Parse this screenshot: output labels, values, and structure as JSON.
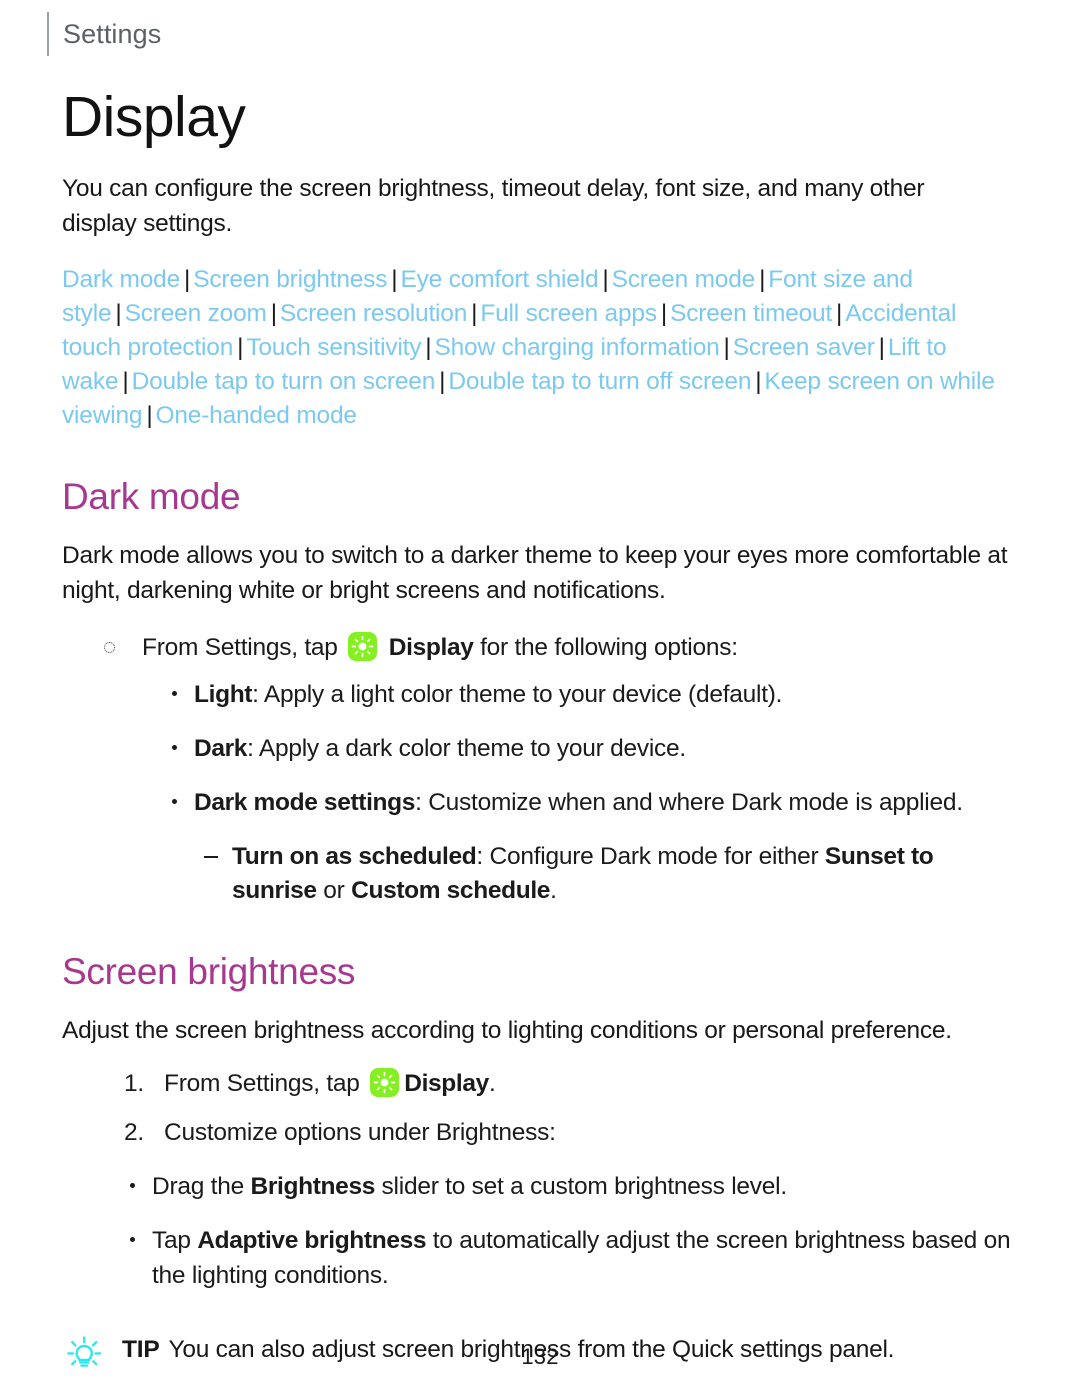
{
  "header": {
    "running_label": "Settings"
  },
  "page": {
    "title": "Display",
    "intro": "You can configure the screen brightness, timeout delay, font size, and many other display settings.",
    "folio": "132"
  },
  "quick_links": {
    "separator": "|",
    "items": [
      "Dark mode",
      "Screen brightness",
      "Eye comfort shield",
      "Screen mode",
      "Font size and style",
      "Screen zoom",
      "Screen resolution",
      "Full screen apps",
      "Screen timeout",
      "Accidental touch protection",
      "Touch sensitivity",
      "Show charging information",
      "Screen saver",
      "Lift to wake",
      "Double tap to turn on screen",
      "Double tap to turn off screen",
      "Keep screen on while viewing",
      "One-handed mode"
    ]
  },
  "sections": {
    "dark_mode": {
      "heading": "Dark mode",
      "body": "Dark mode allows you to switch to a darker theme to keep your eyes more comfortable at night, darkening white or bright screens and notifications.",
      "step": {
        "lead": "From Settings, tap",
        "icon_name": "display-icon",
        "bold_target": "Display",
        "tail": "for the following options:"
      },
      "options": [
        {
          "term": "Light",
          "desc": ": Apply a light color theme to your device (default)."
        },
        {
          "term": "Dark",
          "desc": ": Apply a dark color theme to your device."
        },
        {
          "term": "Dark mode settings",
          "desc": ": Customize when and where Dark mode is applied."
        }
      ],
      "sub_option": {
        "term": "Turn on as scheduled",
        "desc_part1": ": Configure Dark mode for either ",
        "bold_a": "Sunset to sunrise",
        "desc_part2": " or ",
        "bold_b": "Custom schedule",
        "desc_part3": "."
      }
    },
    "screen_brightness": {
      "heading": "Screen brightness",
      "body": "Adjust the screen brightness according to lighting conditions or personal preference.",
      "steps": [
        {
          "number": "1.",
          "lead": "From Settings, tap",
          "icon_name": "display-icon",
          "bold_target": "Display",
          "tail": "."
        },
        {
          "number": "2.",
          "lead": "Customize options under Brightness:",
          "icon_name": "",
          "bold_target": "",
          "tail": ""
        }
      ],
      "bullets": [
        {
          "pre": "Drag the ",
          "bold": "Brightness",
          "post": " slider to set a custom brightness level."
        },
        {
          "pre": "Tap ",
          "bold": "Adaptive brightness",
          "post": " to automatically adjust the screen brightness based on the lighting conditions."
        }
      ]
    }
  },
  "tip": {
    "icon_name": "lightbulb-icon",
    "label": "TIP",
    "text": "You can also adjust screen brightness from the Quick settings panel."
  },
  "colors": {
    "link": "#7cc9f0",
    "heading": "#a7388f",
    "display_icon_bg": "#86ef23",
    "tip_icon": "#2ee8f0",
    "separator": "#1d1d1d"
  }
}
